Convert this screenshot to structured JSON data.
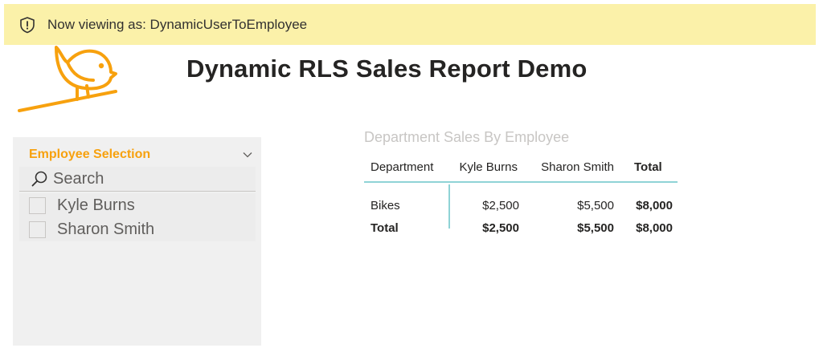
{
  "banner": {
    "icon": "shield-icon",
    "text": "Now viewing as: DynamicUserToEmployee",
    "background": "#fbf1a9"
  },
  "logo": {
    "icon": "bird-logo-icon",
    "color": "#f7a10e"
  },
  "report": {
    "title": "Dynamic RLS Sales Report Demo"
  },
  "slicer": {
    "title": "Employee Selection",
    "title_color": "#f7a10e",
    "search_placeholder": "Search",
    "items": [
      {
        "label": "Kyle Burns",
        "checked": false
      },
      {
        "label": "Sharon Smith",
        "checked": false
      }
    ]
  },
  "matrix": {
    "title": "Department Sales By Employee",
    "headers": [
      "Department",
      "Kyle Burns",
      "Sharon Smith",
      "Total"
    ],
    "rows": [
      {
        "cells": [
          "Bikes",
          "$2,500",
          "$5,500",
          "$8,000"
        ]
      }
    ],
    "total_row": {
      "cells": [
        "Total",
        "$2,500",
        "$5,500",
        "$8,000"
      ]
    },
    "accent_color": "#8fd3d6"
  }
}
